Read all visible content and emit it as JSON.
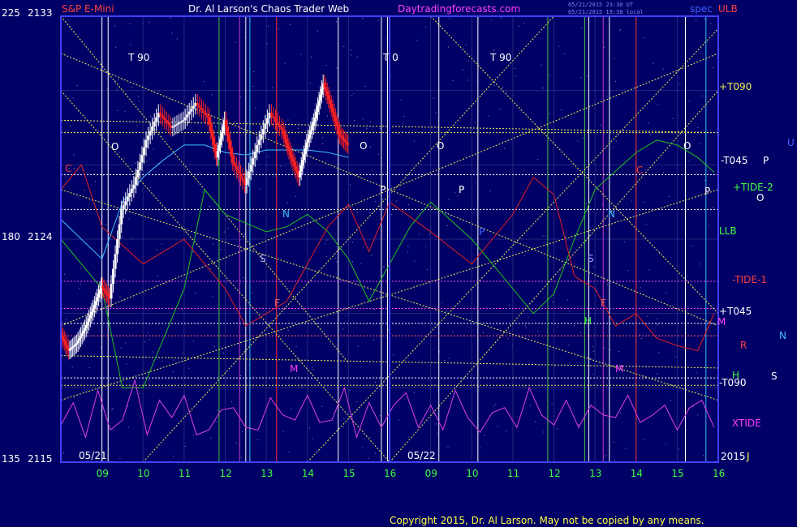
{
  "header": {
    "symbol": "S&P E-Mini",
    "title": "Dr. Al Larson's Chaos Trader Web",
    "site": "Daytradingforecasts.com",
    "stamp1": "05/21/2015 23:30 UT",
    "stamp2": "05/21/2015 19:30 local",
    "spec": "spec",
    "ulb": "ULB"
  },
  "footer": {
    "copyright": "Copyright 2015, Dr. Al Larson. May not be copied by any means."
  },
  "colors": {
    "background": "#000066",
    "price_up": "#ffffff",
    "price_down": "#ff2020",
    "red_line": "#e02020",
    "green_line": "#20c020",
    "cyan_line": "#40c0ff",
    "tide_line": "#e040e0",
    "level_line": "#f0f050"
  },
  "chart_data": {
    "type": "line",
    "title": "S&P E-Mini",
    "y_left_outer_ticks": [
      "225",
      "180",
      "135"
    ],
    "y_left_inner_ticks": [
      "2133",
      "2124",
      "2115"
    ],
    "ylim": [
      2115,
      2133
    ],
    "x_tick_labels": [
      "09",
      "10",
      "11",
      "12",
      "13",
      "14",
      "15",
      "16",
      "09",
      "10",
      "11",
      "12",
      "13",
      "14",
      "15",
      "16"
    ],
    "date_labels": [
      "05/21",
      "05/22"
    ],
    "right_labels": [
      {
        "text": "+T090",
        "color": "#f0f050"
      },
      {
        "text": "-T045",
        "color": "#ffffff"
      },
      {
        "text": "+TIDE-2",
        "color": "#40ff40"
      },
      {
        "text": "LLB",
        "color": "#40ff40"
      },
      {
        "text": "-TIDE-1",
        "color": "#ff4040"
      },
      {
        "text": "+T045",
        "color": "#ffffff"
      },
      {
        "text": "M",
        "color": "#ff40ff"
      },
      {
        "text": "R",
        "color": "#ff4040"
      },
      {
        "text": "H",
        "color": "#40ff40"
      },
      {
        "text": "-T090",
        "color": "#ffffff"
      },
      {
        "text": "XTIDE",
        "color": "#ff40ff"
      },
      {
        "text": "2015",
        "color": "#ffffff"
      },
      {
        "text": "J",
        "color": "#ffff40"
      }
    ],
    "far_right_labels": [
      {
        "text": "U",
        "color": "#4060ff"
      },
      {
        "text": "P",
        "color": "#ffffff"
      },
      {
        "text": "O",
        "color": "#ffffff"
      },
      {
        "text": "N",
        "color": "#40c0ff"
      },
      {
        "text": "S",
        "color": "#ffffff"
      }
    ],
    "in_chart_labels": [
      {
        "text": "T 90"
      },
      {
        "text": "T 0"
      },
      {
        "text": "T 90"
      },
      {
        "text": "O"
      },
      {
        "text": "O"
      },
      {
        "text": "O"
      },
      {
        "text": "O"
      },
      {
        "text": "P"
      },
      {
        "text": "P"
      },
      {
        "text": "P"
      },
      {
        "text": "P"
      },
      {
        "text": "N"
      },
      {
        "text": "N"
      },
      {
        "text": "S"
      },
      {
        "text": "S"
      },
      {
        "text": "M"
      },
      {
        "text": "M"
      },
      {
        "text": "C"
      },
      {
        "text": "C"
      },
      {
        "text": "F"
      },
      {
        "text": "F"
      },
      {
        "text": "H"
      }
    ],
    "series": [
      {
        "key": "price",
        "t": [
          0,
          0.2,
          0.4,
          0.6,
          0.8,
          1.0,
          1.2,
          1.5,
          1.8,
          2.1,
          2.4,
          2.7,
          3.0,
          3.3,
          3.6,
          3.8,
          4.0,
          4.2,
          4.5,
          4.8,
          5.1,
          5.4,
          5.6,
          5.8,
          6.0,
          6.2,
          6.4,
          6.6,
          6.8,
          7.0
        ],
        "v": [
          2120.2,
          2119.5,
          2119.8,
          2120.4,
          2121.2,
          2122.1,
          2121.6,
          2125.2,
          2126.2,
          2128.0,
          2129.1,
          2128.5,
          2128.8,
          2129.5,
          2128.9,
          2127.3,
          2128.8,
          2127.1,
          2126.2,
          2127.8,
          2129.1,
          2128.4,
          2127.4,
          2126.5,
          2127.9,
          2128.9,
          2130.3,
          2129.3,
          2128.2,
          2127.8
        ]
      },
      {
        "key": "green",
        "t": [
          0,
          1,
          1.5,
          2,
          3,
          3.5,
          4,
          5,
          5.5,
          6,
          6.5,
          7,
          7.5,
          8,
          8.5,
          9,
          10,
          11,
          11.5,
          12,
          12.5,
          13,
          14,
          14.5,
          15,
          15.5,
          15.9
        ],
        "v": [
          2124,
          2122,
          2118,
          2118,
          2122,
          2126,
          2125,
          2124.3,
          2124.5,
          2125,
          2124.3,
          2123.2,
          2121.5,
          2123,
          2124.5,
          2125.5,
          2124,
          2122,
          2121,
          2121.8,
          2124,
          2126,
          2127.5,
          2128,
          2127.8,
          2127.3,
          2126.7
        ]
      },
      {
        "key": "red",
        "t": [
          0,
          0.5,
          1,
          2,
          3,
          4,
          4.5,
          5,
          5.5,
          6,
          6.5,
          7,
          7.5,
          8,
          9,
          10,
          11,
          11.5,
          12,
          12.5,
          13,
          13.5,
          14,
          14.5,
          15,
          15.5,
          15.9
        ],
        "v": [
          2126,
          2127,
          2124.5,
          2123,
          2124,
          2122,
          2120.5,
          2121,
          2121.5,
          2123,
          2124.5,
          2125.4,
          2123.5,
          2125.5,
          2124.3,
          2123,
          2125,
          2126.5,
          2125.8,
          2122.5,
          2122,
          2120.5,
          2121,
          2120,
          2119.7,
          2119.5,
          2121
        ]
      },
      {
        "key": "cyan",
        "t": [
          0,
          0.5,
          1,
          1.5,
          2,
          2.5,
          3,
          3.5,
          4,
          4.5,
          5,
          5.5,
          6,
          6.5,
          7
        ],
        "v": [
          2124.8,
          2124,
          2123.2,
          2125.5,
          2126.5,
          2127.2,
          2127.8,
          2127.8,
          2127.5,
          2127.4,
          2127.6,
          2127.6,
          2127.6,
          2127.5,
          2127.3
        ]
      },
      {
        "key": "xtide",
        "t": [
          0,
          0.3,
          0.6,
          0.9,
          1.2,
          1.5,
          1.8,
          2.1,
          2.4,
          2.7,
          3.0,
          3.3,
          3.6,
          3.9,
          4.2,
          4.5,
          4.8,
          5.1,
          5.4,
          5.7,
          6.0,
          6.3,
          6.6,
          6.9,
          7.2,
          7.5,
          7.8,
          8.1,
          8.4,
          8.7,
          9.0,
          9.3,
          9.6,
          9.9,
          10.2,
          10.5,
          10.8,
          11.1,
          11.4,
          11.7,
          12.0,
          12.3,
          12.6,
          12.9,
          13.2,
          13.5,
          13.8,
          14.1,
          14.4,
          14.7,
          15.0,
          15.3,
          15.6,
          15.9
        ],
        "v": [
          2116.5,
          2117.4,
          2116.0,
          2117.9,
          2116.3,
          2116.7,
          2118.3,
          2116.1,
          2117.5,
          2116.8,
          2117.7,
          2116.1,
          2116.3,
          2117.1,
          2117.2,
          2116.4,
          2116.3,
          2117.6,
          2116.9,
          2116.7,
          2117.7,
          2116.6,
          2116.7,
          2118.0,
          2116.0,
          2117.4,
          2116.4,
          2117.3,
          2117.8,
          2116.4,
          2117.3,
          2116.3,
          2117.9,
          2116.8,
          2116.2,
          2117.0,
          2117.2,
          2116.4,
          2118.0,
          2116.9,
          2116.5,
          2117.5,
          2116.4,
          2117.3,
          2116.9,
          2116.8,
          2117.7,
          2116.6,
          2116.9,
          2117.3,
          2116.3,
          2117.2,
          2117.5,
          2116.4
        ]
      }
    ],
    "horizontal_levels": [
      {
        "v": 2128.3,
        "style": "dotted",
        "color": "#f0f050"
      },
      {
        "v": 2126.6,
        "style": "dotted",
        "color": "#ffffff"
      },
      {
        "v": 2125.2,
        "style": "dotted",
        "color": "#ffffff"
      },
      {
        "v": 2122.3,
        "style": "dotted",
        "color": "#ff40ff"
      },
      {
        "v": 2121.2,
        "style": "dotted",
        "color": "#ff40ff"
      },
      {
        "v": 2120.6,
        "style": "dotted",
        "color": "#ffffff"
      },
      {
        "v": 2120.1,
        "style": "dotted",
        "color": "#ff6060"
      },
      {
        "v": 2118.4,
        "style": "dotted",
        "color": "#ffffff"
      },
      {
        "v": 2118.1,
        "style": "dotted",
        "color": "#f0f050"
      }
    ],
    "vertical_lines": [
      {
        "t": 1.0,
        "color": "#ffffff"
      },
      {
        "t": 1.15,
        "color": "#ffffff"
      },
      {
        "t": 3.85,
        "color": "#40c040"
      },
      {
        "t": 4.35,
        "color": "#c040c0"
      },
      {
        "t": 4.5,
        "color": "#ffffff"
      },
      {
        "t": 4.6,
        "color": "#40c0ff"
      },
      {
        "t": 5.25,
        "color": "#ff3030"
      },
      {
        "t": 6.75,
        "color": "#ffffff"
      },
      {
        "t": 7.8,
        "color": "#ffffff"
      },
      {
        "t": 7.95,
        "color": "#ffffff"
      },
      {
        "t": 8.0,
        "color": "#40c0ff"
      },
      {
        "t": 9.2,
        "color": "#ffffff"
      },
      {
        "t": 10.15,
        "color": "#ffffff"
      },
      {
        "t": 11.85,
        "color": "#40c040"
      },
      {
        "t": 12.75,
        "color": "#40c040"
      },
      {
        "t": 12.85,
        "color": "#ffffff"
      },
      {
        "t": 13.2,
        "color": "#c040c0"
      },
      {
        "t": 13.35,
        "color": "#ffffff"
      },
      {
        "t": 14.0,
        "color": "#ff3030"
      },
      {
        "t": 15.2,
        "color": "#ffffff"
      },
      {
        "t": 15.7,
        "color": "#40c0ff"
      }
    ],
    "diagonals": [
      {
        "from": [
          0,
          2131.5
        ],
        "to": [
          16,
          2120.5
        ]
      },
      {
        "from": [
          0,
          2120.5
        ],
        "to": [
          16,
          2131.5
        ]
      },
      {
        "from": [
          0,
          2130.0
        ],
        "to": [
          8,
          2115.0
        ]
      },
      {
        "from": [
          8,
          2115.0
        ],
        "to": [
          16,
          2130.0
        ]
      },
      {
        "from": [
          0,
          2117.5
        ],
        "to": [
          16,
          2126.0
        ]
      },
      {
        "from": [
          0,
          2126.0
        ],
        "to": [
          16,
          2117.5
        ]
      },
      {
        "from": [
          0,
          2133.0
        ],
        "to": [
          7,
          2119.0
        ]
      },
      {
        "from": [
          9,
          2133.0
        ],
        "to": [
          16,
          2121.0
        ]
      },
      {
        "from": [
          2,
          2115.0
        ],
        "to": [
          12,
          2133.0
        ]
      },
      {
        "from": [
          6,
          2115.0
        ],
        "to": [
          16,
          2132.5
        ]
      },
      {
        "from": [
          0,
          2128.8
        ],
        "to": [
          16,
          2128.3
        ]
      },
      {
        "from": [
          0,
          2119.3
        ],
        "to": [
          16,
          2118.8
        ]
      }
    ],
    "grid": true
  }
}
